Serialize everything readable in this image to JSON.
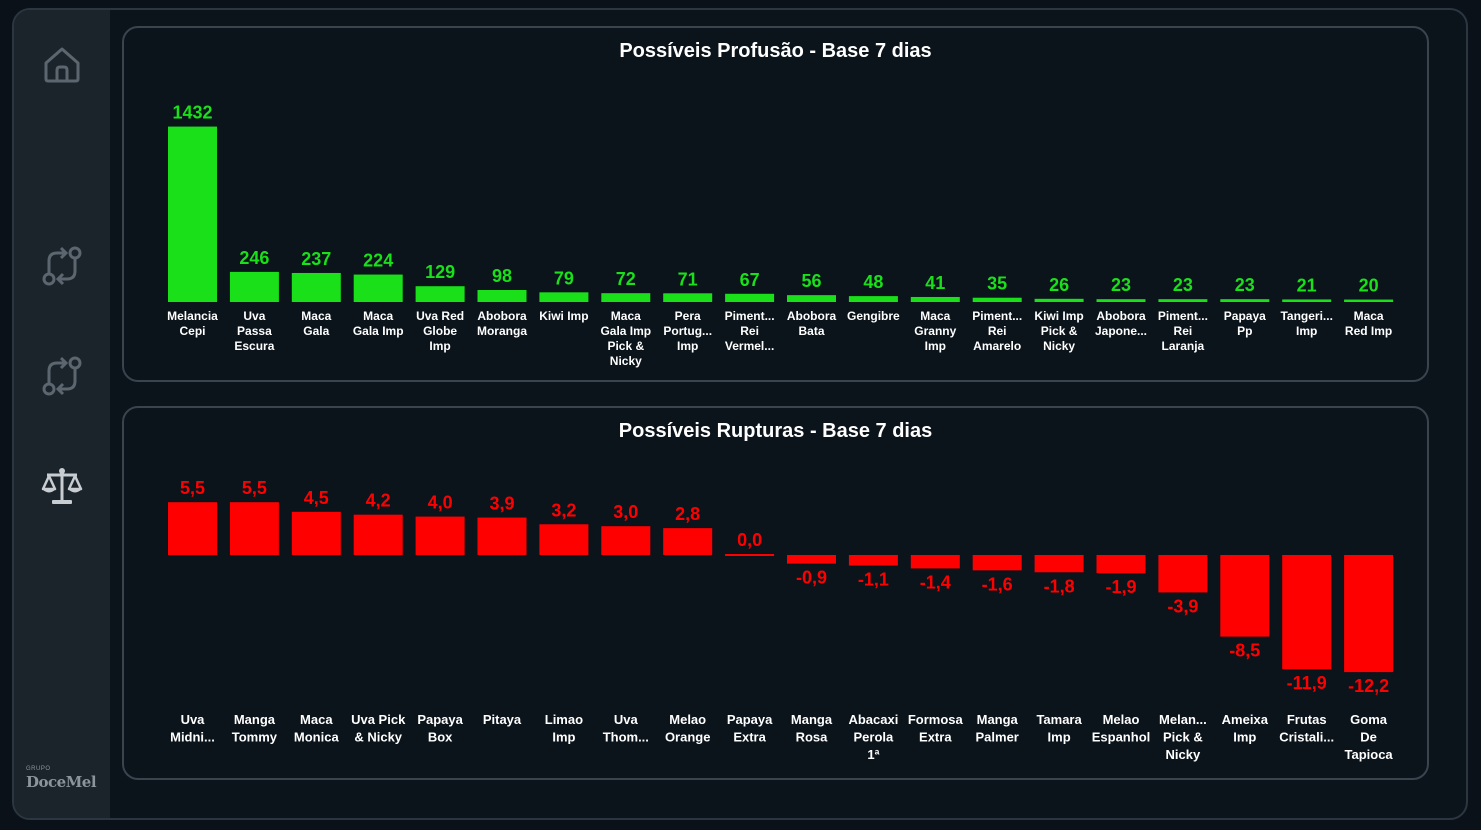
{
  "sidebar": {
    "items": [
      {
        "icon": "home-icon"
      },
      {
        "icon": "compare-arrows-icon"
      },
      {
        "icon": "compare-arrows-icon"
      },
      {
        "icon": "scale-balance-icon"
      }
    ],
    "brand_small": "GRUPO",
    "brand_name": "DoceMel"
  },
  "chart_data": [
    {
      "type": "bar",
      "title": "Possíveis Profusão - Base 7 dias",
      "color": "#19e019",
      "categories": [
        [
          "Melancia",
          "Cepi"
        ],
        [
          "Uva",
          "Passa",
          "Escura"
        ],
        [
          "Maca",
          "Gala"
        ],
        [
          "Maca",
          "Gala Imp"
        ],
        [
          "Uva Red",
          "Globe",
          "Imp"
        ],
        [
          "Abobora",
          "Moranga"
        ],
        [
          "Kiwi Imp"
        ],
        [
          "Maca",
          "Gala Imp",
          "Pick &",
          "Nicky"
        ],
        [
          "Pera",
          "Portug...",
          "Imp"
        ],
        [
          "Piment...",
          "Rei",
          "Vermel..."
        ],
        [
          "Abobora",
          "Bata"
        ],
        [
          "Gengibre"
        ],
        [
          "Maca",
          "Granny",
          "Imp"
        ],
        [
          "Piment...",
          "Rei",
          "Amarelo"
        ],
        [
          "Kiwi Imp",
          "Pick &",
          "Nicky"
        ],
        [
          "Abobora",
          "Japone..."
        ],
        [
          "Piment...",
          "Rei",
          "Laranja"
        ],
        [
          "Papaya",
          "Pp"
        ],
        [
          "Tangeri...",
          "Imp"
        ],
        [
          "Maca",
          "Red Imp"
        ]
      ],
      "values": [
        1432,
        246,
        237,
        224,
        129,
        98,
        79,
        72,
        71,
        67,
        56,
        48,
        41,
        35,
        26,
        23,
        23,
        23,
        21,
        20
      ],
      "labels": [
        "1432",
        "246",
        "237",
        "224",
        "129",
        "98",
        "79",
        "72",
        "71",
        "67",
        "56",
        "48",
        "41",
        "35",
        "26",
        "23",
        "23",
        "23",
        "21",
        "20"
      ]
    },
    {
      "type": "bar",
      "title": "Possíveis Rupturas - Base 7 dias",
      "color": "#ff0000",
      "categories": [
        [
          "Uva",
          "Midni..."
        ],
        [
          "Manga",
          "Tommy"
        ],
        [
          "Maca",
          "Monica"
        ],
        [
          "Uva Pick",
          "& Nicky"
        ],
        [
          "Papaya",
          "Box"
        ],
        [
          "Pitaya"
        ],
        [
          "Limao",
          "Imp"
        ],
        [
          "Uva",
          "Thom..."
        ],
        [
          "Melao",
          "Orange"
        ],
        [
          "Papaya",
          "Extra"
        ],
        [
          "Manga",
          "Rosa"
        ],
        [
          "Abacaxi",
          "Perola",
          "1ª"
        ],
        [
          "Formosa",
          "Extra"
        ],
        [
          "Manga",
          "Palmer"
        ],
        [
          "Tamara",
          "Imp"
        ],
        [
          "Melao",
          "Espanhol"
        ],
        [
          "Melan...",
          "Pick &",
          "Nicky"
        ],
        [
          "Ameixa",
          "Imp"
        ],
        [
          "Frutas",
          "Cristali..."
        ],
        [
          "Goma",
          "De",
          "Tapioca"
        ]
      ],
      "values": [
        5.5,
        5.5,
        4.5,
        4.2,
        4.0,
        3.9,
        3.2,
        3.0,
        2.8,
        0.0,
        -0.9,
        -1.1,
        -1.4,
        -1.6,
        -1.8,
        -1.9,
        -3.9,
        -8.5,
        -11.9,
        -12.2
      ],
      "labels": [
        "5,5",
        "5,5",
        "4,5",
        "4,2",
        "4,0",
        "3,9",
        "3,2",
        "3,0",
        "2,8",
        "0,0",
        "-0,9",
        "-1,1",
        "-1,4",
        "-1,6",
        "-1,8",
        "-1,9",
        "-3,9",
        "-8,5",
        "-11,9",
        "-12,2"
      ]
    }
  ]
}
